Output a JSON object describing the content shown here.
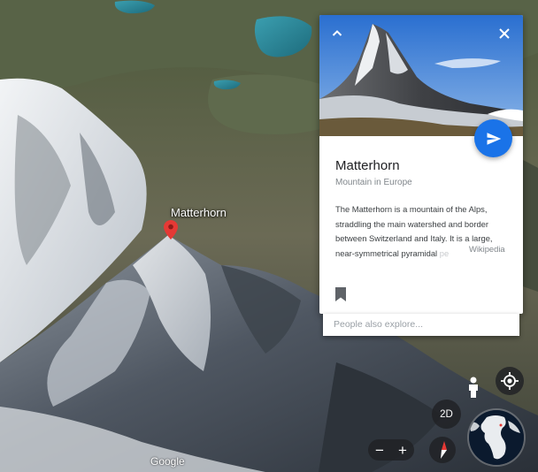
{
  "map": {
    "place_label": "Matterhorn",
    "attribution": "Google"
  },
  "card": {
    "title": "Matterhorn",
    "subtitle": "Mountain in Europe",
    "description": "The Matterhorn is a mountain of the Alps, straddling the main watershed and border between Switzerland and Italy. It is a large, near-symmetrical pyramidal",
    "description_fade": " pe",
    "source": "Wikipedia"
  },
  "explore": {
    "placeholder": "People also explore..."
  },
  "controls": {
    "mode_toggle": "2D",
    "zoom_out": "−",
    "zoom_in": "+"
  },
  "icons": {
    "collapse": "chevron-up-icon",
    "close": "close-icon",
    "share": "send-icon",
    "bookmark": "bookmark-icon",
    "pegman": "person-icon",
    "locate": "my-location-icon",
    "compass": "compass-icon",
    "globe": "globe-icon"
  },
  "colors": {
    "accent": "#1a73e8",
    "pin": "#e53935",
    "control_bg": "#202124"
  }
}
